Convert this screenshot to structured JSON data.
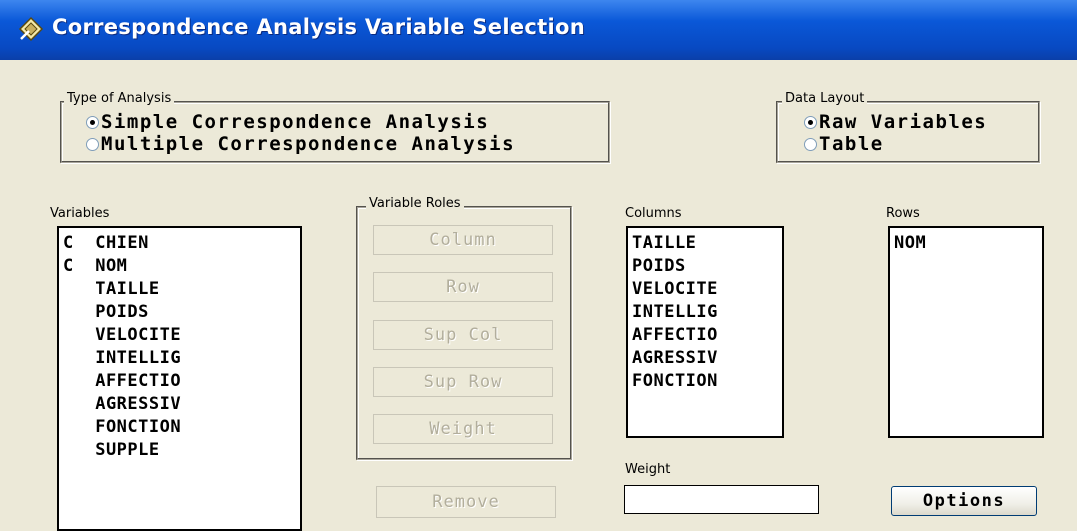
{
  "window": {
    "title": "Correspondence Analysis Variable Selection"
  },
  "analysis_type": {
    "legend": "Type of Analysis",
    "options": [
      {
        "label": "Simple Correspondence Analysis",
        "selected": true
      },
      {
        "label": "Multiple Correspondence Analysis",
        "selected": false
      }
    ]
  },
  "data_layout": {
    "legend": "Data Layout",
    "options": [
      {
        "label": "Raw Variables",
        "selected": true
      },
      {
        "label": "Table",
        "selected": false
      }
    ]
  },
  "variables": {
    "label": "Variables",
    "items": [
      "C  CHIEN",
      "C  NOM",
      "   TAILLE",
      "   POIDS",
      "   VELOCITE",
      "   INTELLIG",
      "   AFFECTIO",
      "   AGRESSIV",
      "   FONCTION",
      "   SUPPLE"
    ]
  },
  "variable_roles": {
    "legend": "Variable Roles",
    "buttons": [
      "Column",
      "Row",
      "Sup Col",
      "Sup Row",
      "Weight"
    ]
  },
  "remove_button": "Remove",
  "columns": {
    "label": "Columns",
    "items": [
      "TAILLE",
      "POIDS",
      "VELOCITE",
      "INTELLIG",
      "AFFECTIO",
      "AGRESSIV",
      "FONCTION"
    ]
  },
  "rows": {
    "label": "Rows",
    "items": [
      "NOM"
    ]
  },
  "weight": {
    "label": "Weight",
    "value": ""
  },
  "options_button": "Options"
}
